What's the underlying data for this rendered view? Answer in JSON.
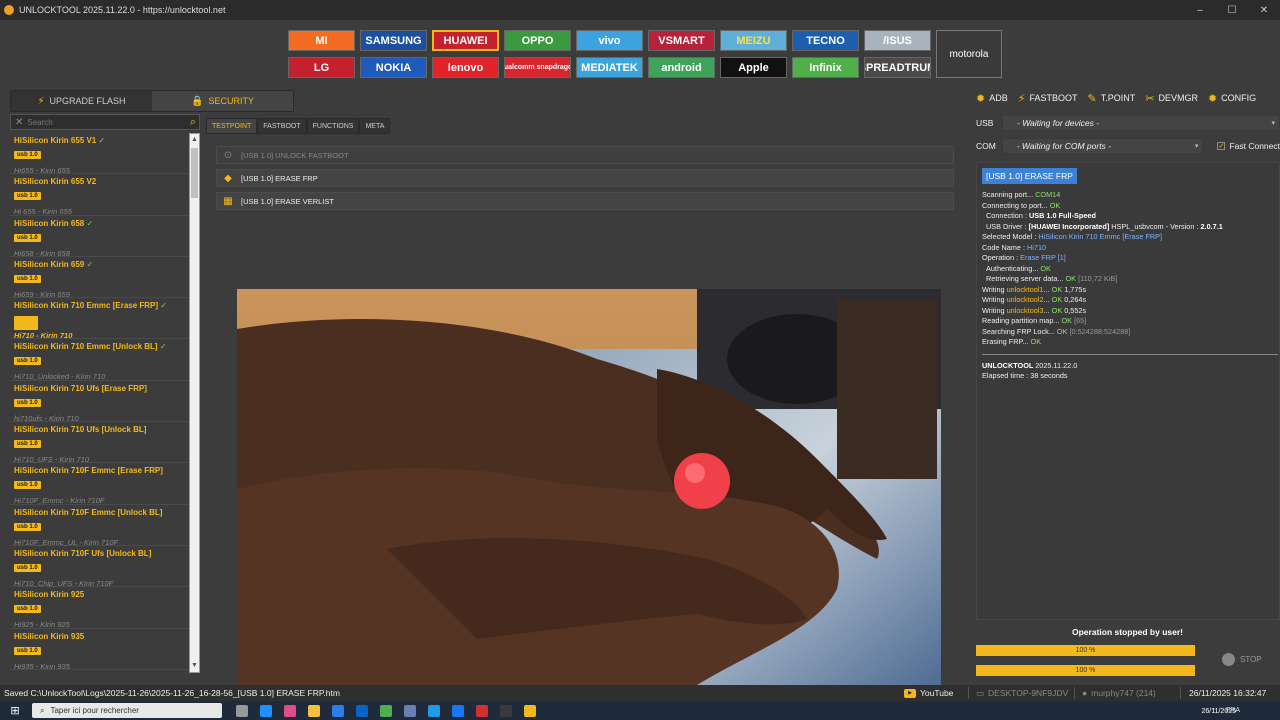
{
  "window": {
    "title": "UNLOCKTOOL 2025.11.22.0 - https://unlocktool.net"
  },
  "brands": [
    {
      "label": "MI",
      "color": "#f36c21",
      "fg": "#ffffff"
    },
    {
      "label": "SAMSUNG",
      "color": "#1c4fa0",
      "fg": "#ffffff"
    },
    {
      "label": "HUAWEI",
      "color": "#c5202e",
      "fg": "#ffffff"
    },
    {
      "label": "OPPO",
      "color": "#3b9a3f",
      "fg": "#ffffff"
    },
    {
      "label": "vivo",
      "color": "#3da2e0",
      "fg": "#ffffff"
    },
    {
      "label": "VSMART",
      "color": "#b5223a",
      "fg": "#ffffff"
    },
    {
      "label": "MEIZU",
      "color": "#5fb0d8",
      "fg": "#f8e04a"
    },
    {
      "label": "TECNO",
      "color": "#1d5fae",
      "fg": "#ffffff"
    },
    {
      "label": "/ISUS",
      "color": "#a8b3bd",
      "fg": "#ffffff"
    },
    {
      "label": "LG",
      "color": "#c5202e",
      "fg": "#ffffff"
    },
    {
      "label": "NOKIA",
      "color": "#1e5bbd",
      "fg": "#ffffff"
    },
    {
      "label": "lenovo",
      "color": "#e2232a",
      "fg": "#ffffff"
    },
    {
      "label": "Qualcomm snapdragon",
      "color": "#d7262e",
      "fg": "#ffffff"
    },
    {
      "label": "MEDIATEK",
      "color": "#3aa5d8",
      "fg": "#ffffff"
    },
    {
      "label": "android",
      "color": "#3fa45a",
      "fg": "#ffffff"
    },
    {
      "label": "Apple",
      "color": "#111111",
      "fg": "#ffffff"
    },
    {
      "label": "Infinix",
      "color": "#4fb04a",
      "fg": "#ffffff"
    },
    {
      "label": "SPREADTRUM",
      "color": "#4a4a4a",
      "fg": "#ffffff"
    }
  ],
  "brand_moto": "motorola",
  "left_tabs": [
    {
      "label": "UPGRADE FLASH"
    },
    {
      "label": "SECURITY"
    }
  ],
  "search": {
    "placeholder": "Search"
  },
  "models": [
    {
      "name": "HiSilicon Kirin 655 V1",
      "check": "✓",
      "badge": "usb 1.0",
      "code": "Hi655 - Kirin 655"
    },
    {
      "name": "HiSilicon Kirin 655 V2",
      "check": "",
      "badge": "usb 1.0",
      "code": "Hi 655 - Kirin 655"
    },
    {
      "name": "HiSilicon Kirin 658",
      "check": "✓",
      "badge": "usb 1.0",
      "code": "Hi658 - Kirin 658"
    },
    {
      "name": "HiSilicon Kirin 659",
      "check": "✓",
      "badge": "usb 1.0",
      "code": "Hi659 - Kirin 659"
    },
    {
      "name": "HiSilicon Kirin 710 Emmc [Erase FRP]",
      "check": "✓",
      "badge": "usb 1.0",
      "code": "Hi710 - Kirin 710",
      "selected": true
    },
    {
      "name": "HiSilicon Kirin 710 Emmc [Unlock BL]",
      "check": "✓",
      "badge": "usb 1.0",
      "code": "Hi710_Unlocked - Kirin 710"
    },
    {
      "name": "HiSilicon Kirin 710 Ufs [Erase FRP]",
      "check": "",
      "badge": "usb 1.0",
      "code": "hi710ufs - Kirin 710"
    },
    {
      "name": "HiSilicon Kirin 710 Ufs [Unlock BL]",
      "check": "",
      "badge": "usb 1.0",
      "code": "Hi710_UFS - Kirin 710"
    },
    {
      "name": "HiSilicon Kirin 710F Emmc [Erase FRP]",
      "check": "",
      "badge": "usb 1.0",
      "code": "Hi710F_Emmc - Kirin 710F"
    },
    {
      "name": "HiSilicon Kirin 710F Emmc [Unlock BL]",
      "check": "",
      "badge": "usb 1.0",
      "code": "Hi710F_Emmc_UL - Kirin 710F"
    },
    {
      "name": "HiSilicon Kirin 710F Ufs [Unlock BL]",
      "check": "",
      "badge": "usb 1.0",
      "code": "Hi710_Chip_UFS - Kirin 710F"
    },
    {
      "name": "HiSilicon Kirin 925",
      "check": "",
      "badge": "usb 1.0",
      "code": "Hi925 - Kirin 925"
    },
    {
      "name": "HiSilicon Kirin 935",
      "check": "",
      "badge": "usb 1.0",
      "code": "Hi935 - Kirin 935"
    }
  ],
  "sub_tabs": [
    {
      "label": "TESTPOINT"
    },
    {
      "label": "FASTBOOT"
    },
    {
      "label": "FUNCTIONS"
    },
    {
      "label": "META"
    }
  ],
  "actions": [
    {
      "label": "[USB 1.0] UNLOCK FASTBOOT"
    },
    {
      "label": "[USB 1.0] ERASE FRP"
    },
    {
      "label": "[USB 1.0] ERASE VERLIST"
    }
  ],
  "right_toolbar": [
    {
      "label": "ADB"
    },
    {
      "label": "FASTBOOT"
    },
    {
      "label": "T.POINT"
    },
    {
      "label": "DEVMGR"
    },
    {
      "label": "CONFIG"
    }
  ],
  "ports": {
    "usb_label": "USB",
    "usb_value": "- Waiting for devices -",
    "com_label": "COM",
    "com_value": "- Waiting for COM ports -",
    "fast_connect": "Fast Connect"
  },
  "log": {
    "title": "[USB 1.0] ERASE FRP",
    "l1a": "Scanning port... ",
    "l1b": "COM14",
    "l2a": "Connecting to port... ",
    "l2b": "OK",
    "l3a": "Connection : ",
    "l3b": "USB 1.0 Full-Speed",
    "l4a": "USB Driver : ",
    "l4b": "[HUAWEI Incorporated]",
    "l4c": " HSPL_usbvcom - Version : ",
    "l4d": "2.0.7.1",
    "l5a": "Selected Model : ",
    "l5b": "HiSilicon Kirin 710 Emmc [Erase FRP]",
    "l6a": "Code Name : ",
    "l6b": "Hi710",
    "l7a": "Operation : ",
    "l7b": "Erase FRP [1]",
    "l8a": "Authenticating... ",
    "l8b": "OK",
    "l9a": "Retrieving server data... ",
    "l9b": "OK",
    "l9c": " [110,72 KiB]",
    "l10a": "Writing ",
    "l10b": "unlocktool1",
    "l10c": "... ",
    "l10d": "OK",
    "l10e": " 1,775s",
    "l11a": "Writing ",
    "l11b": "unlocktool2",
    "l11c": "... ",
    "l11d": "OK",
    "l11e": " 0,264s",
    "l12a": "Writing ",
    "l12b": "unlocktool3",
    "l12c": "... ",
    "l12d": "OK",
    "l12e": " 0,552s",
    "l13a": "Reading partition map... ",
    "l13b": "OK",
    "l13c": " [65]",
    "l14a": "Searching FRP Lock... ",
    "l14b": "OK",
    "l14c": " [0:524288:524288]",
    "l15a": "Erasing FRP... ",
    "l15b": "OK",
    "v1a": "UNLOCKTOOL ",
    "v1b": "2025.11.22.0",
    "v2": "Elapsed time : 38 seconds"
  },
  "operation_status": "Operation stopped by user!",
  "progress1": {
    "value": 100,
    "text": "100 %"
  },
  "progress2": {
    "value": 100,
    "text": "100 %"
  },
  "stop_label": "STOP",
  "status": {
    "path": "Saved C:\\UnlockTool\\Logs\\2025-11-26\\2025-11-26_16-28-56_[USB 1.0] ERASE FRP.htm",
    "youtube": "YouTube",
    "pc": "DESKTOP-9NF9JDV",
    "user": "murphy747 (214)",
    "datetime": "26/11/2025 16:32:47"
  },
  "taskbar": {
    "search_placeholder": "Taper ici pour rechercher",
    "lang": "FRA",
    "date": "26/11/2025"
  },
  "colors": {
    "accent": "#f3b91c",
    "ok": "#8ee06a",
    "link": "#7fb3ff",
    "log_header": "#3b82d6"
  }
}
